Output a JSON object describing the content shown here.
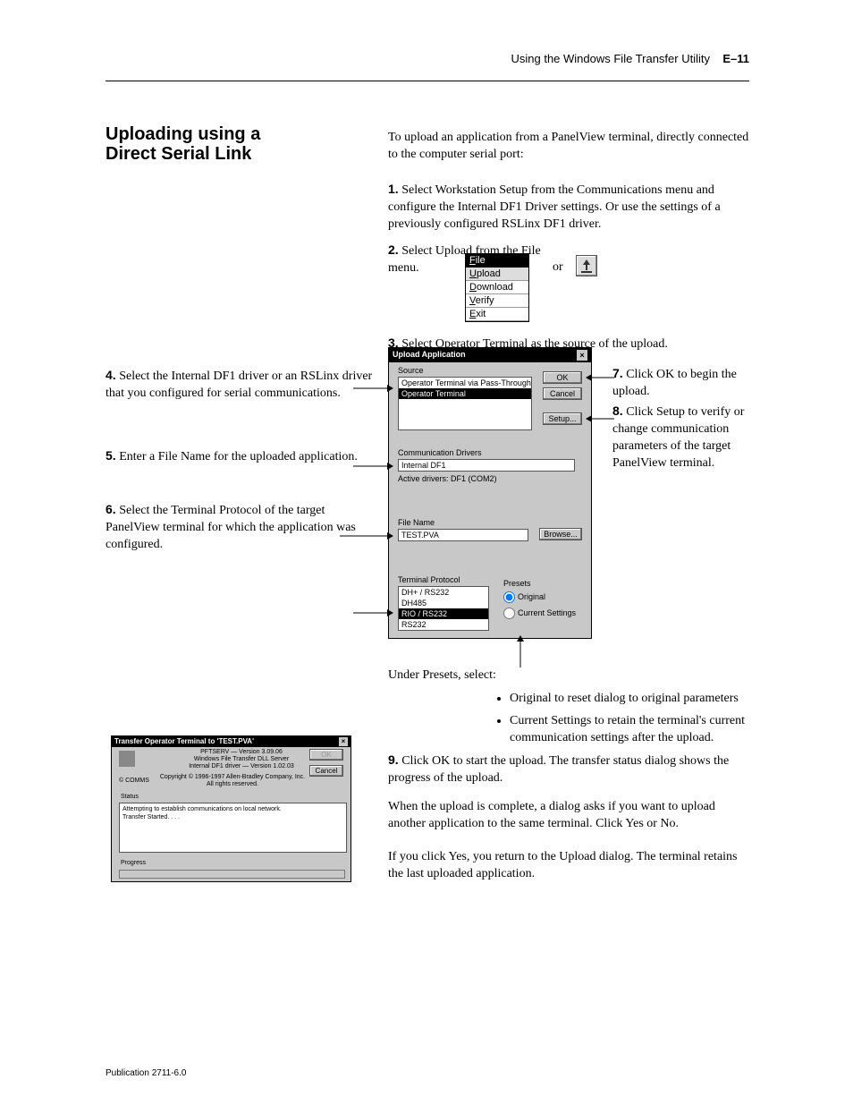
{
  "header": {
    "title": "Using the Windows File Transfer Utility",
    "page_num": "E–11"
  },
  "section_title_line1": "Uploading using a",
  "section_title_line2": "Direct Serial Link",
  "step1": "To upload an application from a PanelView terminal, directly connected to the computer serial port:",
  "step1_num": "1.",
  "step1_text": "Select Workstation Setup from the Communications menu and configure the Internal DF1 Driver settings. Or use the settings of a previously configured RSLinx DF1 driver.",
  "step2_num": "2.",
  "step2_text": "Select Upload from the File menu.",
  "or": "or",
  "step3_num": "3.",
  "step3_text": "Select Operator Terminal as the source of the upload.",
  "step4_num": "4.",
  "step4_text": "Select the Internal DF1 driver or an RSLinx driver that you configured for serial communications.",
  "step5_num": "5.",
  "step5_text": "Enter a File Name for the uploaded application.",
  "step6_num": "6.",
  "step6_text": "Select the Terminal Protocol of the target PanelView terminal for which the application was configured.",
  "step7_num": "7.",
  "step7_text": "Click OK to begin the upload.",
  "step8_num": "8.",
  "step8_text": "Click Setup to verify or change communication parameters of the target PanelView terminal.",
  "presets_label": "Under Presets, select:",
  "presets": [
    "Original to reset dialog to original parameters",
    "Current Settings to retain the terminal's current communication settings after the upload."
  ],
  "step9_num": "9.",
  "step9_text": "Click OK to start the upload. The transfer status dialog shows the progress of the upload.",
  "step10": "When the upload is complete, a dialog asks if you want to upload another application to the same terminal. Click Yes or No.",
  "step11": "If you click Yes, you return to the Upload dialog. The terminal retains the last uploaded application.",
  "pubnum": "Publication 2711-6.0",
  "menu": {
    "title": "File",
    "items": [
      "Upload",
      "Download",
      "Verify",
      "Exit"
    ],
    "underlines": [
      "F",
      "U",
      "D",
      "V",
      "E"
    ]
  },
  "dlg": {
    "title": "Upload Application",
    "close": "×",
    "source_lbl": "Source",
    "source_rows": [
      "Operator Terminal via Pass-Through",
      "Operator Terminal"
    ],
    "ok": "OK",
    "cancel": "Cancel",
    "setup": "Setup...",
    "comm_lbl": "Communication Drivers",
    "comm_val": "Internal DF1",
    "active_lbl": "Active drivers: DF1 (COM2)",
    "file_lbl": "File Name",
    "file_val": "TEST.PVA",
    "browse": "Browse...",
    "proto_lbl": "Terminal Protocol",
    "proto_rows": [
      "DH+ / RS232",
      "DH485",
      "RIO / RS232",
      "RS232"
    ],
    "presets_lbl": "Presets",
    "preset_orig": "Original",
    "preset_cur": "Current Settings"
  },
  "dlg2": {
    "title": "Transfer Operator Terminal to 'TEST.PVA'",
    "close": "×",
    "ver1": "PFTSERV — Version 3.09.06",
    "ver2": "Windows File Transfer DLL Server",
    "ver3": "Internal DF1 driver — Version 1.02.03",
    "copy1": "Copyright © 1996-1997 Allen-Bradley Company, Inc.",
    "copy2": "All rights reserved.",
    "comms": "© COMMS",
    "ok": "OK",
    "cancel": "Cancel",
    "status_lbl": "Status",
    "status1": "Attempting to establish communications on local network.",
    "status2": "Transfer Started. . . .",
    "progress_lbl": "Progress"
  }
}
